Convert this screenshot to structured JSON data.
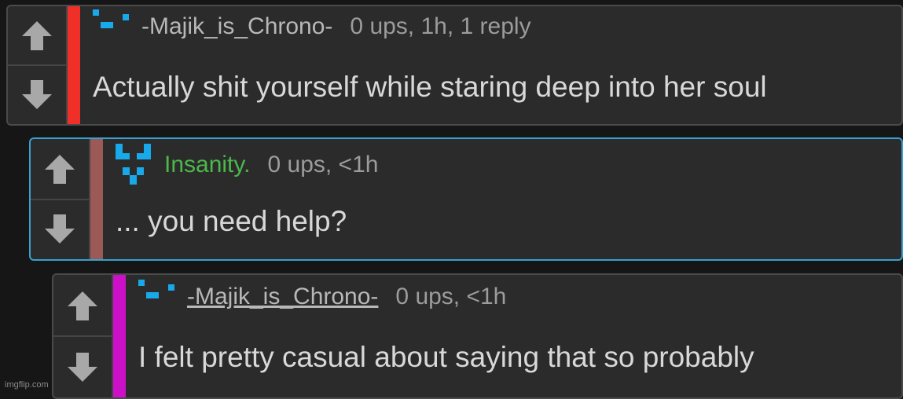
{
  "comments": [
    {
      "username": "-Majik_is_Chrono-",
      "stats": "0 ups, 1h, 1 reply",
      "text": "Actually shit yourself while staring deep into her soul",
      "depth_color": "#f03028"
    },
    {
      "username": "Insanity.",
      "stats": "0 ups, <1h",
      "text": "... you need help?",
      "depth_color": "#9b5a55",
      "username_color": "#4cb84a"
    },
    {
      "username": "-Majik_is_Chrono-",
      "stats": "0 ups, <1h",
      "text": "I felt pretty casual about saying that so probably",
      "depth_color": "#cc10c8"
    }
  ],
  "icons": {
    "upvote": "arrow-up-icon",
    "downvote": "arrow-down-icon",
    "avatar": "pixel-avatar-icon"
  },
  "colors": {
    "background": "#161616",
    "panel": "#2b2b2b",
    "highlight_border": "#3aa0d0",
    "avatar_blue": "#17a9ea"
  },
  "watermark": "imgflip.com"
}
